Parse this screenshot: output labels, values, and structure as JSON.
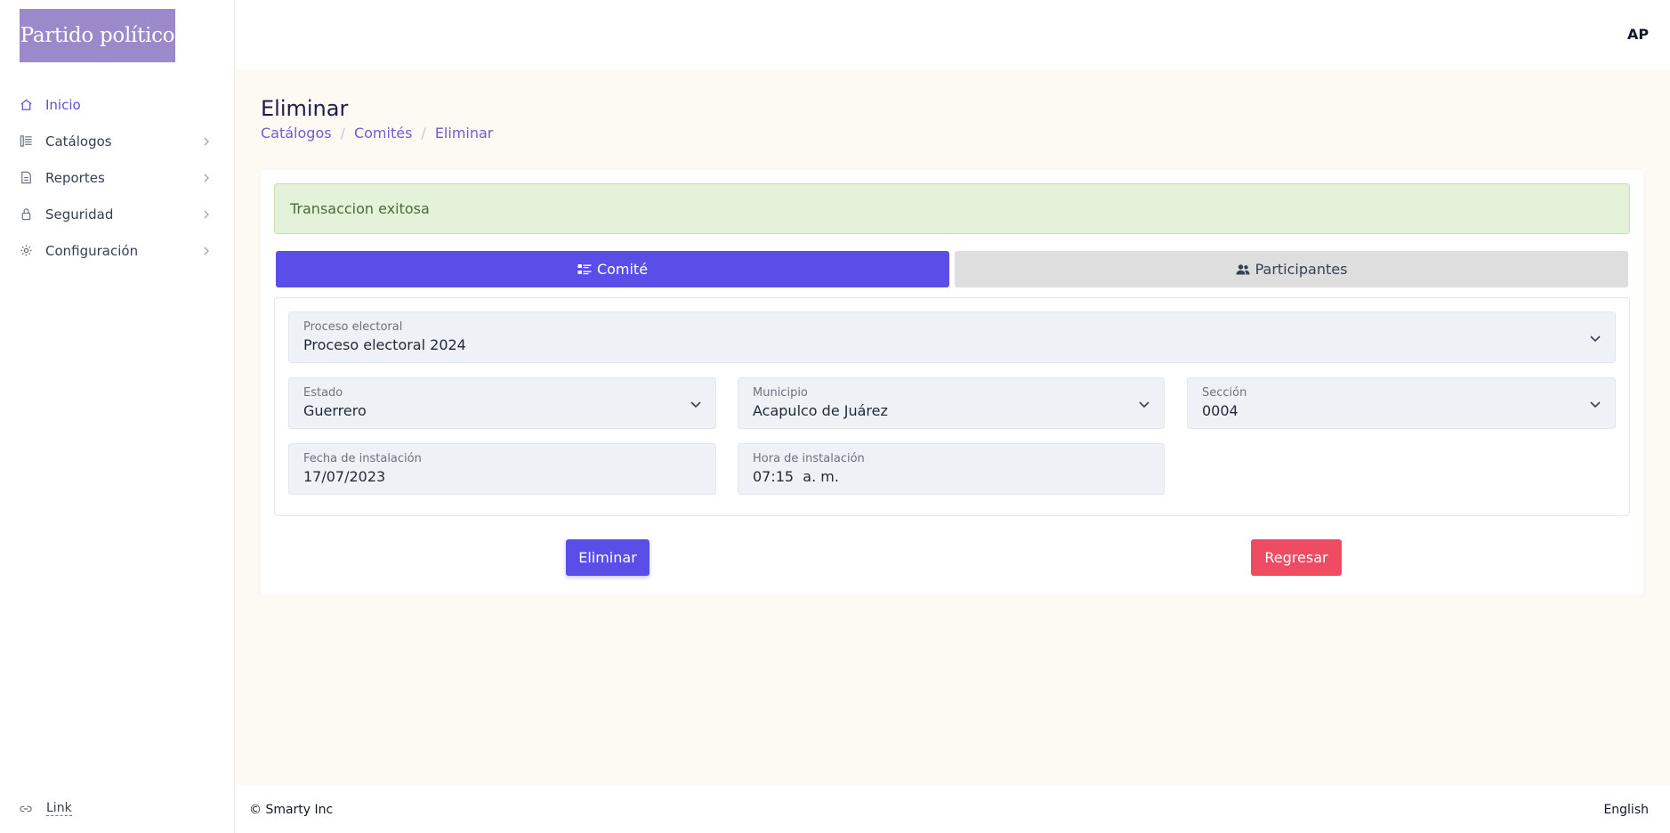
{
  "sidebar": {
    "logo": "Partido político",
    "items": [
      {
        "label": "Inicio",
        "icon": "home-icon"
      },
      {
        "label": "Catálogos",
        "icon": "catalog-icon"
      },
      {
        "label": "Reportes",
        "icon": "report-icon"
      },
      {
        "label": "Seguridad",
        "icon": "lock-icon"
      },
      {
        "label": "Configuración",
        "icon": "gear-icon"
      }
    ],
    "footer_link": "Link"
  },
  "topbar": {
    "avatar": "AP"
  },
  "header": {
    "title": "Eliminar",
    "breadcrumb": [
      "Catálogos",
      "Comités",
      "Eliminar"
    ]
  },
  "alert": {
    "message": "Transaccion exitosa"
  },
  "tabs": [
    {
      "label": "Comité",
      "icon": "list-icon"
    },
    {
      "label": "Participantes",
      "icon": "users-icon"
    }
  ],
  "form": {
    "proceso": {
      "label": "Proceso electoral",
      "value": "Proceso electoral 2024"
    },
    "estado": {
      "label": "Estado",
      "value": "Guerrero"
    },
    "municipio": {
      "label": "Municipio",
      "value": "Acapulco de Juárez"
    },
    "seccion": {
      "label": "Sección",
      "value": "0004"
    },
    "fecha": {
      "label": "Fecha de instalación",
      "value": "17/07/2023"
    },
    "hora": {
      "label": "Hora de instalación",
      "value": "07:15  a. m."
    }
  },
  "actions": {
    "delete": "Eliminar",
    "back": "Regresar"
  },
  "footer": {
    "copyright": "© Smarty Inc",
    "language": "English"
  },
  "colors": {
    "primary": "#5b4de8",
    "danger": "#ef4b63",
    "success_bg": "#e3f2d9",
    "logo_bg": "#9b89c9"
  }
}
